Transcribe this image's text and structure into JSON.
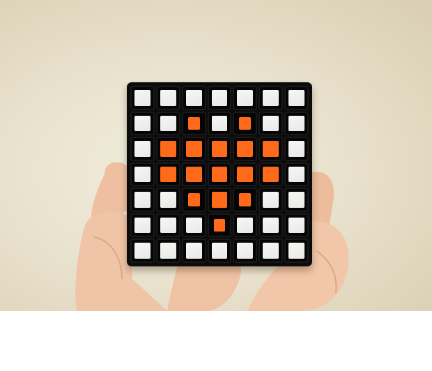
{
  "scene": {
    "subject": "cube-face",
    "grid_size": 7,
    "colors": {
      "background": "#e9e2cd",
      "cube_body": "#0b0b0b",
      "white": "#f2f2f0",
      "orange": "#ff6a1a",
      "skin": "#f0c2a4"
    },
    "pattern": [
      [
        "white",
        "white",
        "white",
        "white",
        "white",
        "white",
        "white"
      ],
      [
        "white",
        "white",
        "orange",
        "white",
        "orange",
        "white",
        "white"
      ],
      [
        "white",
        "orange",
        "orange",
        "orange",
        "orange",
        "orange",
        "white"
      ],
      [
        "white",
        "orange",
        "orange",
        "orange",
        "orange",
        "orange",
        "white"
      ],
      [
        "white",
        "white",
        "orange",
        "orange",
        "orange",
        "white",
        "white"
      ],
      [
        "white",
        "white",
        "white",
        "orange",
        "white",
        "white",
        "white"
      ],
      [
        "white",
        "white",
        "white",
        "white",
        "white",
        "white",
        "white"
      ]
    ]
  }
}
